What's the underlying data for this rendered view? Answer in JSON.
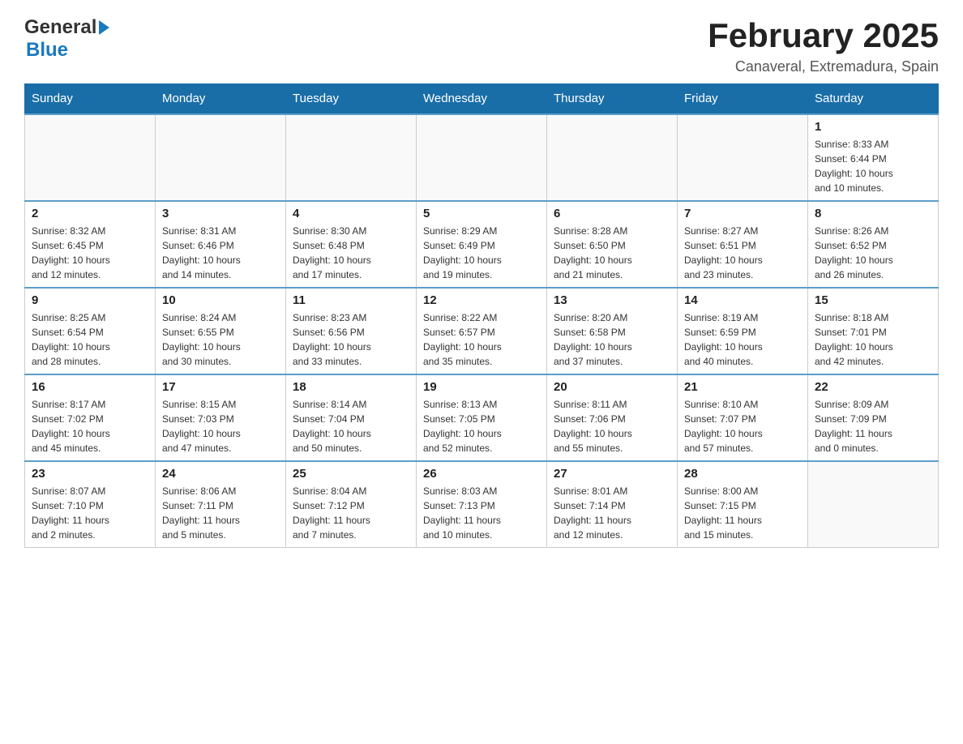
{
  "header": {
    "logo_general": "General",
    "logo_blue": "Blue",
    "month_title": "February 2025",
    "location": "Canaveral, Extremadura, Spain"
  },
  "weekdays": [
    "Sunday",
    "Monday",
    "Tuesday",
    "Wednesday",
    "Thursday",
    "Friday",
    "Saturday"
  ],
  "weeks": [
    [
      {
        "day": "",
        "info": ""
      },
      {
        "day": "",
        "info": ""
      },
      {
        "day": "",
        "info": ""
      },
      {
        "day": "",
        "info": ""
      },
      {
        "day": "",
        "info": ""
      },
      {
        "day": "",
        "info": ""
      },
      {
        "day": "1",
        "info": "Sunrise: 8:33 AM\nSunset: 6:44 PM\nDaylight: 10 hours\nand 10 minutes."
      }
    ],
    [
      {
        "day": "2",
        "info": "Sunrise: 8:32 AM\nSunset: 6:45 PM\nDaylight: 10 hours\nand 12 minutes."
      },
      {
        "day": "3",
        "info": "Sunrise: 8:31 AM\nSunset: 6:46 PM\nDaylight: 10 hours\nand 14 minutes."
      },
      {
        "day": "4",
        "info": "Sunrise: 8:30 AM\nSunset: 6:48 PM\nDaylight: 10 hours\nand 17 minutes."
      },
      {
        "day": "5",
        "info": "Sunrise: 8:29 AM\nSunset: 6:49 PM\nDaylight: 10 hours\nand 19 minutes."
      },
      {
        "day": "6",
        "info": "Sunrise: 8:28 AM\nSunset: 6:50 PM\nDaylight: 10 hours\nand 21 minutes."
      },
      {
        "day": "7",
        "info": "Sunrise: 8:27 AM\nSunset: 6:51 PM\nDaylight: 10 hours\nand 23 minutes."
      },
      {
        "day": "8",
        "info": "Sunrise: 8:26 AM\nSunset: 6:52 PM\nDaylight: 10 hours\nand 26 minutes."
      }
    ],
    [
      {
        "day": "9",
        "info": "Sunrise: 8:25 AM\nSunset: 6:54 PM\nDaylight: 10 hours\nand 28 minutes."
      },
      {
        "day": "10",
        "info": "Sunrise: 8:24 AM\nSunset: 6:55 PM\nDaylight: 10 hours\nand 30 minutes."
      },
      {
        "day": "11",
        "info": "Sunrise: 8:23 AM\nSunset: 6:56 PM\nDaylight: 10 hours\nand 33 minutes."
      },
      {
        "day": "12",
        "info": "Sunrise: 8:22 AM\nSunset: 6:57 PM\nDaylight: 10 hours\nand 35 minutes."
      },
      {
        "day": "13",
        "info": "Sunrise: 8:20 AM\nSunset: 6:58 PM\nDaylight: 10 hours\nand 37 minutes."
      },
      {
        "day": "14",
        "info": "Sunrise: 8:19 AM\nSunset: 6:59 PM\nDaylight: 10 hours\nand 40 minutes."
      },
      {
        "day": "15",
        "info": "Sunrise: 8:18 AM\nSunset: 7:01 PM\nDaylight: 10 hours\nand 42 minutes."
      }
    ],
    [
      {
        "day": "16",
        "info": "Sunrise: 8:17 AM\nSunset: 7:02 PM\nDaylight: 10 hours\nand 45 minutes."
      },
      {
        "day": "17",
        "info": "Sunrise: 8:15 AM\nSunset: 7:03 PM\nDaylight: 10 hours\nand 47 minutes."
      },
      {
        "day": "18",
        "info": "Sunrise: 8:14 AM\nSunset: 7:04 PM\nDaylight: 10 hours\nand 50 minutes."
      },
      {
        "day": "19",
        "info": "Sunrise: 8:13 AM\nSunset: 7:05 PM\nDaylight: 10 hours\nand 52 minutes."
      },
      {
        "day": "20",
        "info": "Sunrise: 8:11 AM\nSunset: 7:06 PM\nDaylight: 10 hours\nand 55 minutes."
      },
      {
        "day": "21",
        "info": "Sunrise: 8:10 AM\nSunset: 7:07 PM\nDaylight: 10 hours\nand 57 minutes."
      },
      {
        "day": "22",
        "info": "Sunrise: 8:09 AM\nSunset: 7:09 PM\nDaylight: 11 hours\nand 0 minutes."
      }
    ],
    [
      {
        "day": "23",
        "info": "Sunrise: 8:07 AM\nSunset: 7:10 PM\nDaylight: 11 hours\nand 2 minutes."
      },
      {
        "day": "24",
        "info": "Sunrise: 8:06 AM\nSunset: 7:11 PM\nDaylight: 11 hours\nand 5 minutes."
      },
      {
        "day": "25",
        "info": "Sunrise: 8:04 AM\nSunset: 7:12 PM\nDaylight: 11 hours\nand 7 minutes."
      },
      {
        "day": "26",
        "info": "Sunrise: 8:03 AM\nSunset: 7:13 PM\nDaylight: 11 hours\nand 10 minutes."
      },
      {
        "day": "27",
        "info": "Sunrise: 8:01 AM\nSunset: 7:14 PM\nDaylight: 11 hours\nand 12 minutes."
      },
      {
        "day": "28",
        "info": "Sunrise: 8:00 AM\nSunset: 7:15 PM\nDaylight: 11 hours\nand 15 minutes."
      },
      {
        "day": "",
        "info": ""
      }
    ]
  ]
}
